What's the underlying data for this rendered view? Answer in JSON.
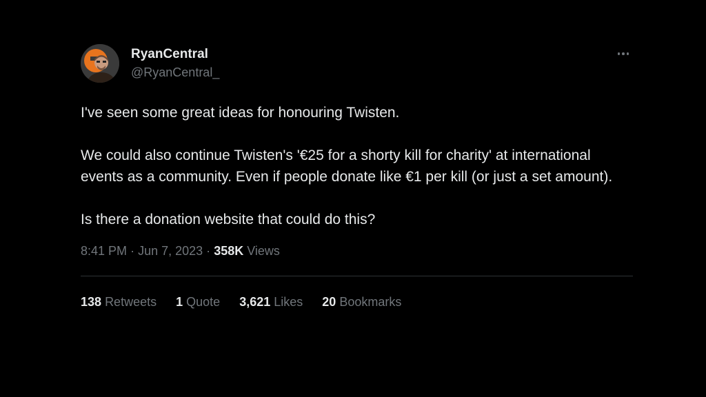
{
  "author": {
    "display_name": "RyanCentral",
    "handle": "@RyanCentral_"
  },
  "tweet": {
    "paragraphs": [
      "I've seen some great ideas for honouring Twisten.",
      "We could also continue Twisten's '€25 for a shorty kill for charity' at international events as a community. Even if people donate like €1 per kill (or just a set amount).",
      "Is there a donation website that could do this?"
    ],
    "time": "8:41 PM",
    "separator": "·",
    "date": "Jun 7, 2023",
    "views_count": "358K",
    "views_label": "Views"
  },
  "stats": {
    "retweets": {
      "count": "138",
      "label": "Retweets"
    },
    "quotes": {
      "count": "1",
      "label": "Quote"
    },
    "likes": {
      "count": "3,621",
      "label": "Likes"
    },
    "bookmarks": {
      "count": "20",
      "label": "Bookmarks"
    }
  },
  "icons": {
    "more": "more-options-icon",
    "avatar": "avatar"
  },
  "colors": {
    "background": "#000000",
    "primary_text": "#e7e9ea",
    "secondary_text": "#71767b",
    "divider": "#2f3336"
  }
}
